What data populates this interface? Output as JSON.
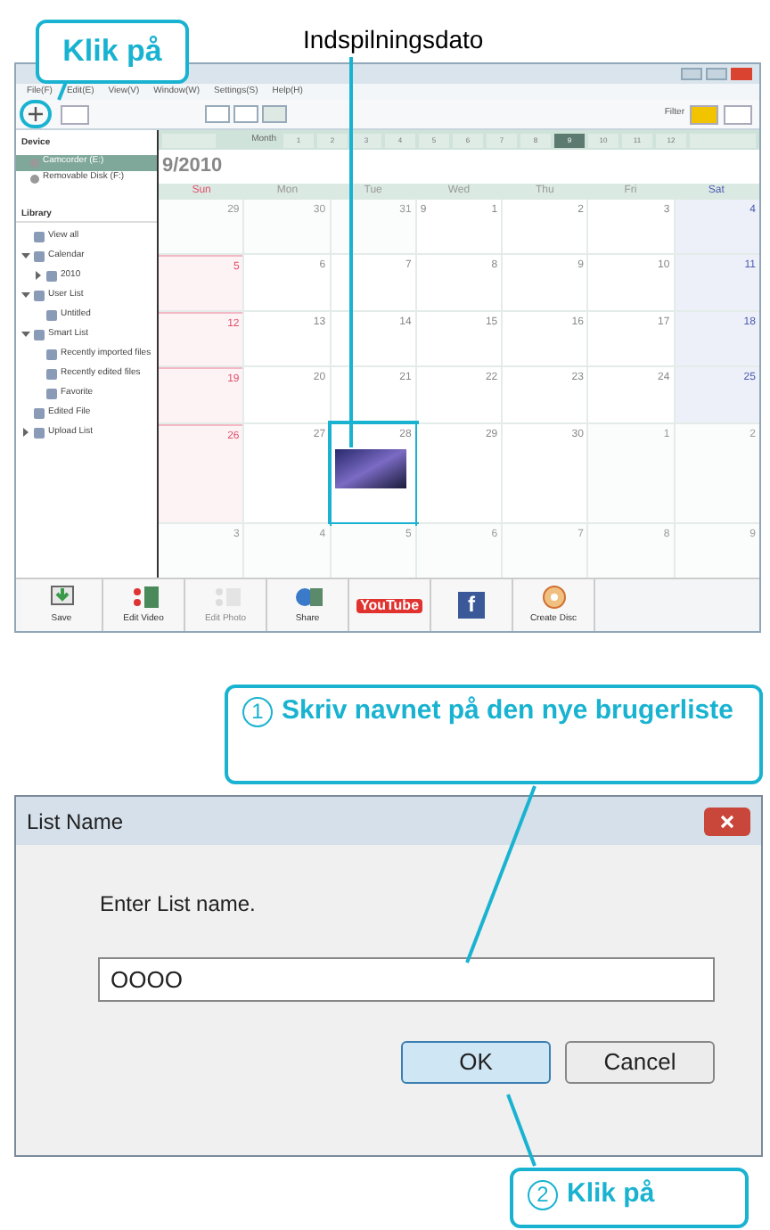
{
  "callout_top": {
    "text": "Klik på"
  },
  "annotation": {
    "label": "Indspilningsdato"
  },
  "app": {
    "menu": [
      "File(F)",
      "Edit(E)",
      "View(V)",
      "Window(W)",
      "Settings(S)",
      "Help(H)"
    ],
    "filter_label": "Filter",
    "sidebar": {
      "device_title": "Device",
      "devices": [
        {
          "label": "Camcorder (E:)",
          "selected": true
        },
        {
          "label": "Removable Disk (F:)",
          "selected": false
        }
      ],
      "library_title": "Library",
      "library": [
        {
          "label": "View all"
        },
        {
          "label": "Calendar",
          "expanded": true,
          "children": [
            {
              "label": "2010",
              "expanded": false
            }
          ]
        },
        {
          "label": "User List",
          "expanded": true,
          "children": [
            {
              "label": "Untitled"
            }
          ]
        },
        {
          "label": "Smart List",
          "expanded": true,
          "children": [
            {
              "label": "Recently imported files"
            },
            {
              "label": "Recently edited files"
            },
            {
              "label": "Favorite"
            }
          ]
        },
        {
          "label": "Edited File"
        },
        {
          "label": "Upload List",
          "expanded": false
        }
      ]
    },
    "month_bar": {
      "label": "Month",
      "months": [
        {
          "label": "1",
          "selected": false
        },
        {
          "label": "2",
          "selected": false
        },
        {
          "label": "3",
          "selected": false
        },
        {
          "label": "4",
          "selected": false
        },
        {
          "label": "5",
          "selected": false
        },
        {
          "label": "6",
          "selected": false
        },
        {
          "label": "7",
          "selected": false
        },
        {
          "label": "8",
          "selected": false
        },
        {
          "label": "9",
          "selected": true
        },
        {
          "label": "10",
          "selected": false
        },
        {
          "label": "11",
          "selected": false
        },
        {
          "label": "12",
          "selected": false
        }
      ]
    },
    "calendar": {
      "title": "9/2010",
      "weekdays": [
        "Sun",
        "Mon",
        "Tue",
        "Wed",
        "Thu",
        "Fri",
        "Sat"
      ],
      "weeks": [
        [
          {
            "day": "29",
            "in_month": false
          },
          {
            "day": "30",
            "in_month": false
          },
          {
            "day": "31",
            "in_month": false
          },
          {
            "day": "1",
            "in_month": true,
            "month_mark": "9"
          },
          {
            "day": "2",
            "in_month": true
          },
          {
            "day": "3",
            "in_month": true
          },
          {
            "day": "4",
            "in_month": true
          }
        ],
        [
          {
            "day": "5",
            "in_month": true
          },
          {
            "day": "6",
            "in_month": true
          },
          {
            "day": "7",
            "in_month": true
          },
          {
            "day": "8",
            "in_month": true
          },
          {
            "day": "9",
            "in_month": true
          },
          {
            "day": "10",
            "in_month": true
          },
          {
            "day": "11",
            "in_month": true
          }
        ],
        [
          {
            "day": "12",
            "in_month": true
          },
          {
            "day": "13",
            "in_month": true
          },
          {
            "day": "14",
            "in_month": true
          },
          {
            "day": "15",
            "in_month": true
          },
          {
            "day": "16",
            "in_month": true
          },
          {
            "day": "17",
            "in_month": true
          },
          {
            "day": "18",
            "in_month": true
          }
        ],
        [
          {
            "day": "19",
            "in_month": true
          },
          {
            "day": "20",
            "in_month": true
          },
          {
            "day": "21",
            "in_month": true
          },
          {
            "day": "22",
            "in_month": true
          },
          {
            "day": "23",
            "in_month": true
          },
          {
            "day": "24",
            "in_month": true
          },
          {
            "day": "25",
            "in_month": true
          }
        ],
        [
          {
            "day": "26",
            "in_month": true
          },
          {
            "day": "27",
            "in_month": true
          },
          {
            "day": "28",
            "in_month": true,
            "has_media": true
          },
          {
            "day": "29",
            "in_month": true
          },
          {
            "day": "30",
            "in_month": true
          },
          {
            "day": "1",
            "in_month": false
          },
          {
            "day": "2",
            "in_month": false
          }
        ],
        [
          {
            "day": "3",
            "in_month": false
          },
          {
            "day": "4",
            "in_month": false
          },
          {
            "day": "5",
            "in_month": false
          },
          {
            "day": "6",
            "in_month": false
          },
          {
            "day": "7",
            "in_month": false
          },
          {
            "day": "8",
            "in_month": false
          },
          {
            "day": "9",
            "in_month": false
          }
        ]
      ]
    },
    "actions": [
      {
        "kind": "save",
        "label": "Save",
        "disabled": false
      },
      {
        "kind": "edit_video",
        "label": "Edit Video",
        "disabled": false
      },
      {
        "kind": "edit_photo",
        "label": "Edit Photo",
        "disabled": true
      },
      {
        "kind": "share",
        "label": "Share",
        "disabled": false
      },
      {
        "kind": "youtube",
        "label": "YouTube",
        "disabled": false
      },
      {
        "kind": "facebook",
        "label": "f",
        "disabled": false
      },
      {
        "kind": "disc",
        "label": "Create Disc",
        "disabled": false
      }
    ]
  },
  "callout_middle": {
    "number": "1",
    "text": "Skriv navnet på den nye brugerliste"
  },
  "dialog": {
    "title": "List Name",
    "prompt": "Enter List name.",
    "value": "OOOO",
    "buttons": [
      {
        "label": "OK",
        "selected": true
      },
      {
        "label": "Cancel",
        "selected": false
      }
    ]
  },
  "callout_bottom": {
    "number": "2",
    "text": "Klik på"
  }
}
